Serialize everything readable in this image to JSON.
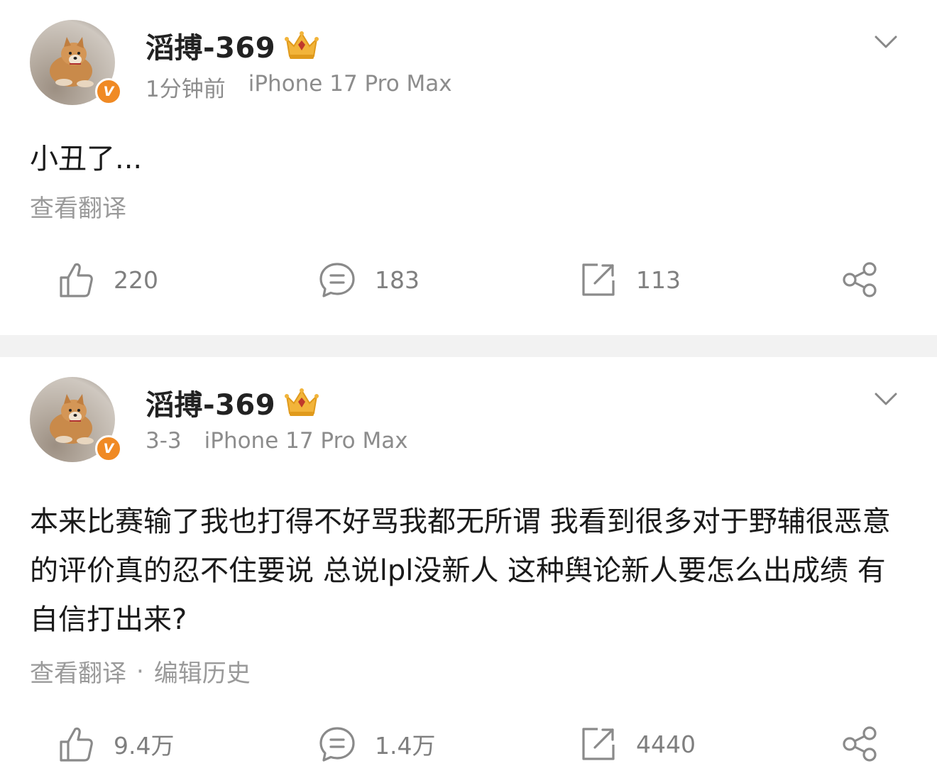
{
  "posts": [
    {
      "username": "滔搏-369",
      "time": "1分钟前",
      "device": "iPhone 17 Pro Max",
      "content": "小丑了...",
      "links": [
        "查看翻译"
      ],
      "likes": "220",
      "comments": "183",
      "reposts": "113"
    },
    {
      "username": "滔搏-369",
      "time": "3-3",
      "device": "iPhone 17 Pro Max",
      "content": "本来比赛输了我也打得不好骂我都无所谓  我看到很多对于野辅很恶意的评价真的忍不住要说 总说lpl没新人 这种舆论新人要怎么出成绩 有自信打出来?",
      "links": [
        "查看翻译",
        "编辑历史"
      ],
      "link_separator": "·",
      "likes": "9.4万",
      "comments": "1.4万",
      "reposts": "4440"
    }
  ],
  "verified_badge": "V",
  "icons": {
    "like": "thumbs-up-icon",
    "comment": "comment-bubble-icon",
    "repost": "repost-icon",
    "share": "share-icon",
    "more": "chevron-down-icon",
    "crown": "crown-badge-icon"
  },
  "colors": {
    "badge": "#f08a24",
    "crown": "#f2b43a",
    "meta": "#8c8c8c",
    "separator": "#f2f2f2"
  }
}
